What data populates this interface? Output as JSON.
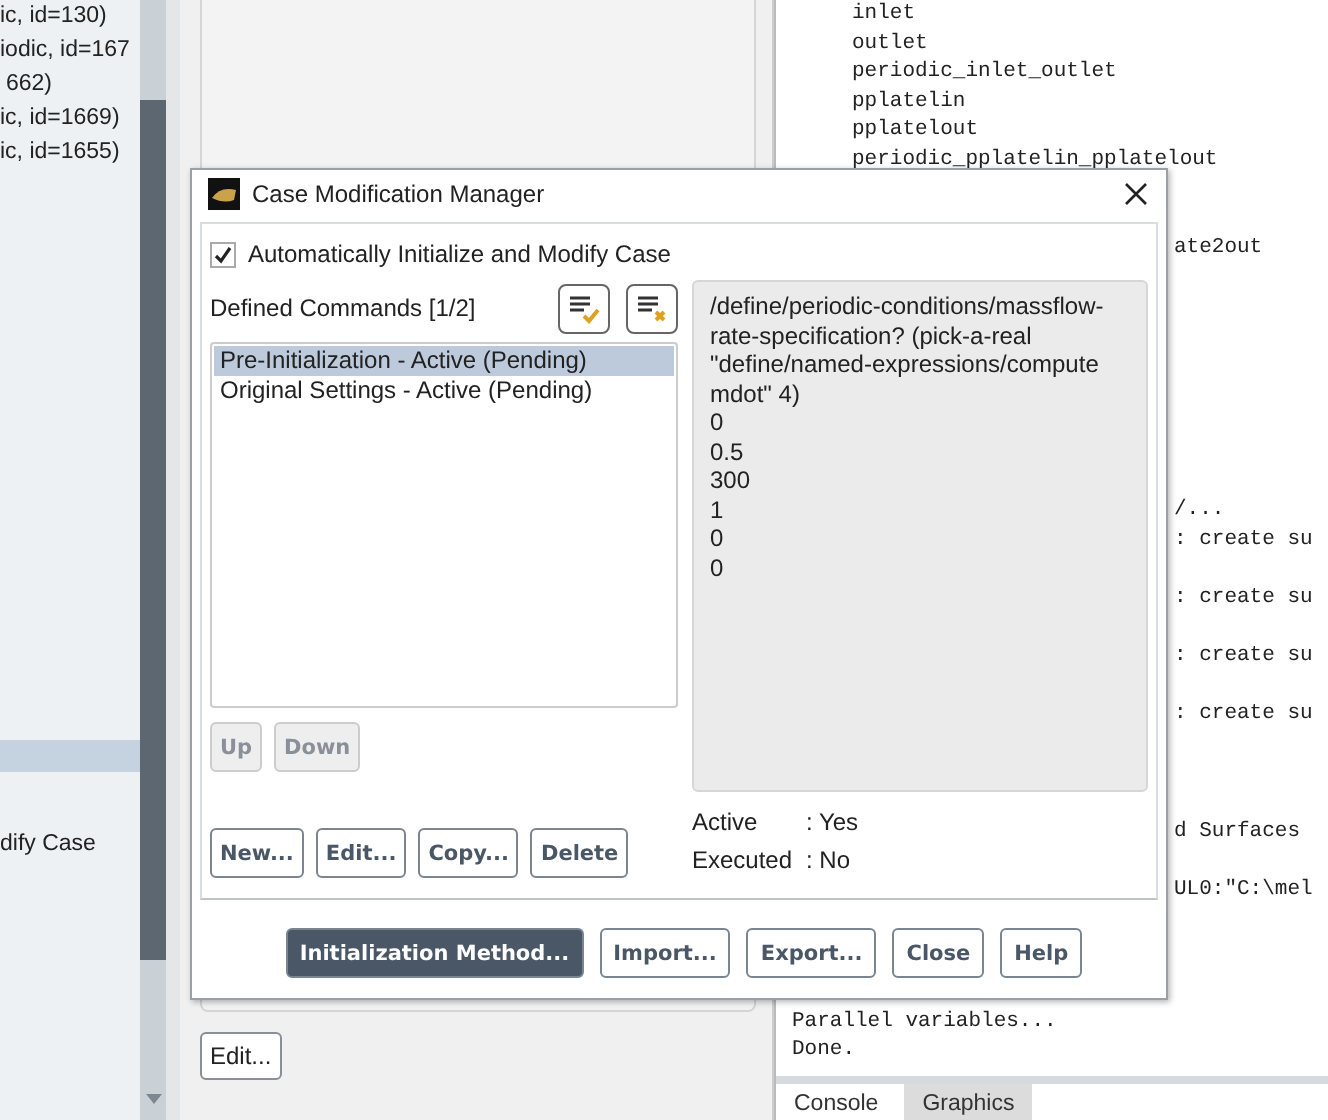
{
  "tree_panel": {
    "items": [
      {
        "label": "ic, id=130)",
        "selected": false
      },
      {
        "label": "iodic, id=167",
        "selected": false
      },
      {
        "label": "662)",
        "selected": false
      },
      {
        "label": "ic, id=1669)",
        "selected": false
      },
      {
        "label": "ic, id=1655)",
        "selected": false
      }
    ],
    "lower_items": [
      {
        "selected": true
      },
      {
        "label": "dify Case",
        "selected": false
      }
    ]
  },
  "middle_panel": {
    "buttons": [
      "Edit..."
    ]
  },
  "console": {
    "lines_above": [
      "inlet",
      "outlet",
      "periodic_inlet_outlet",
      "pplatelin",
      "pplatelout",
      "periodic_pplatelin_pplatelout"
    ],
    "lines_beside": [
      "ate2out",
      "/...",
      ": create su",
      ": create su",
      ": create su",
      ": create su",
      "d Surfaces",
      "UL0:\"C:\\mel"
    ],
    "lines_below": [
      "Parallel variables...",
      "Done."
    ],
    "tabs": [
      {
        "label": "Console",
        "selected": true
      },
      {
        "label": "Graphics",
        "selected": false
      }
    ]
  },
  "dialog": {
    "title": "Case Modification Manager",
    "auto_init": {
      "label": "Automatically Initialize and Modify Case",
      "checked": true
    },
    "commands_label": "Defined Commands [1/2]",
    "commands": [
      {
        "label": "Pre-Initialization - Active (Pending)",
        "selected": true
      },
      {
        "label": "Original Settings - Active (Pending)",
        "selected": false
      }
    ],
    "move_buttons": [
      {
        "label": "Up",
        "disabled": true
      },
      {
        "label": "Down",
        "disabled": true
      }
    ],
    "edit_buttons": [
      "New...",
      "Edit...",
      "Copy...",
      "Delete"
    ],
    "command_text": [
      "/define/periodic-conditions/massflow-rate-specification? (pick-a-real \"define/named-expressions/compute mdot\" 4)",
      "0",
      "0.5",
      "300",
      "1",
      "0",
      "0"
    ],
    "status": [
      {
        "label": "Active",
        "value": ": Yes"
      },
      {
        "label": "Executed",
        "value": ": No"
      }
    ],
    "footer_buttons": [
      {
        "label": "Initialization Method...",
        "selected": true
      },
      {
        "label": "Import...",
        "selected": false
      },
      {
        "label": "Export...",
        "selected": false
      },
      {
        "label": "Close",
        "selected": false
      },
      {
        "label": "Help",
        "selected": false
      }
    ]
  }
}
